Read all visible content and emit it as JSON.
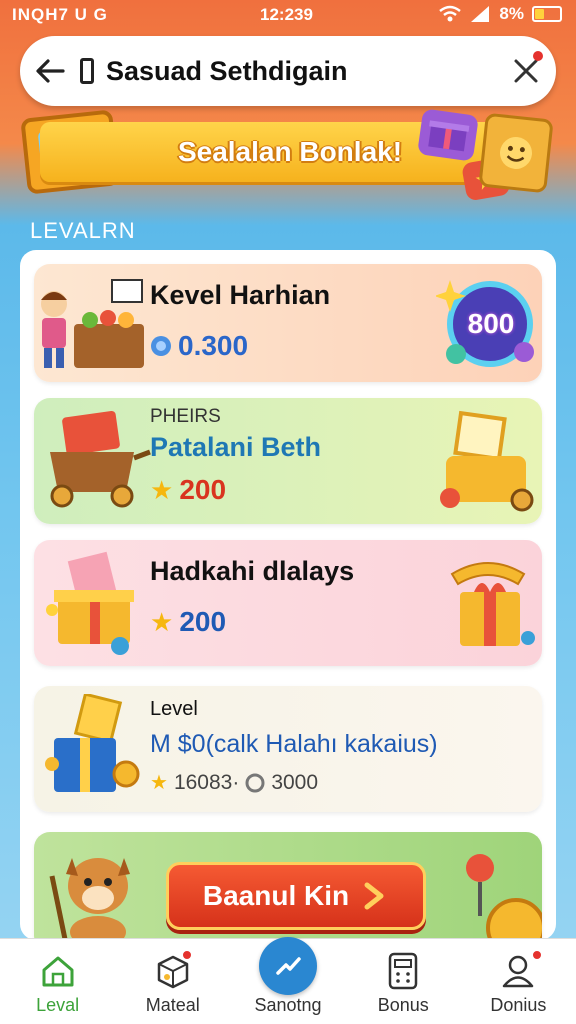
{
  "status_bar": {
    "left_text": "INQH7 U G",
    "time": "12:239",
    "battery_text": "8%"
  },
  "search_bar": {
    "title": "Sasuad Sethdigain"
  },
  "banner": {
    "text": "Sealalan Bonlak!"
  },
  "section_label": "LEVALRN",
  "cards": [
    {
      "title": "Kevel Harhian",
      "value": "0.300",
      "badge_value": "800"
    },
    {
      "label": "PHEIRS",
      "title": "Patalani Beth",
      "value": "200"
    },
    {
      "title": "Hadkahi dlalays",
      "value": "200"
    },
    {
      "label": "Level",
      "title": "M $0(calk Halahı kakaius)",
      "value_a": "16083·",
      "value_b": "3000"
    }
  ],
  "cta": {
    "label": "Baanul Kin"
  },
  "nav": {
    "items": [
      {
        "label": "Leval",
        "icon": "home-icon",
        "active": true
      },
      {
        "label": "Mateal",
        "icon": "box-icon",
        "badge": true
      },
      {
        "label": "Sanotng",
        "icon": "check-icon"
      },
      {
        "label": "Bonus",
        "icon": "calculator-icon"
      },
      {
        "label": "Donius",
        "icon": "user-icon",
        "badge": true
      }
    ]
  },
  "colors": {
    "accent_green": "#3da33a",
    "accent_blue": "#2a87d1",
    "cta_red": "#e0401f",
    "banner_yellow": "#ffcb3c"
  }
}
